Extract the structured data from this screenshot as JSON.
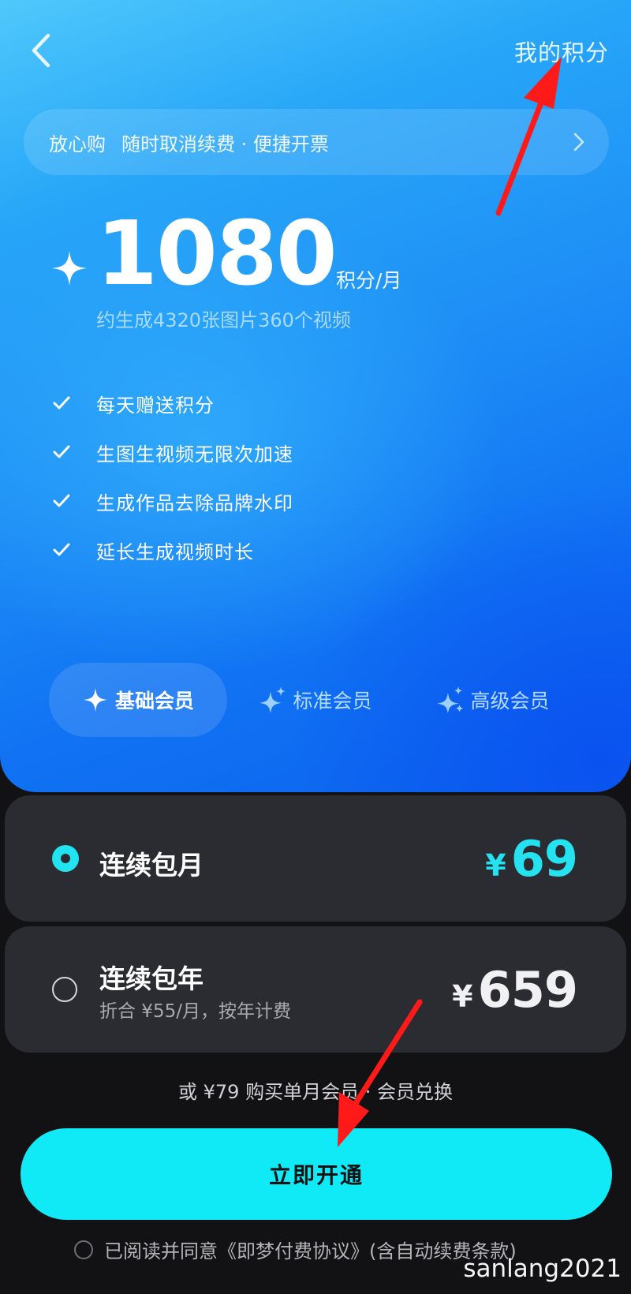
{
  "header": {
    "back_icon": "chevron-left-icon",
    "my_points_label": "我的积分"
  },
  "banner": {
    "tag": "放心购",
    "text": "随时取消续费 · 便捷开票",
    "arrow_icon": "chevron-right-icon"
  },
  "plan_summary": {
    "points": "1080",
    "unit": "积分/月",
    "subtitle": "约生成4320张图片360个视频"
  },
  "features": [
    {
      "label": "每天赠送积分"
    },
    {
      "label": "生图生视频无限次加速"
    },
    {
      "label": "生成作品去除品牌水印"
    },
    {
      "label": "延长生成视频时长"
    }
  ],
  "tiers": [
    {
      "label": "基础会员",
      "active": true
    },
    {
      "label": "标准会员",
      "active": false
    },
    {
      "label": "高级会员",
      "active": false
    }
  ],
  "plans": {
    "monthly": {
      "name": "连续包月",
      "currency": "¥",
      "price": "69",
      "selected": true
    },
    "yearly": {
      "name": "连续包年",
      "sub": "折合 ¥55/月，按年计费",
      "currency": "¥",
      "price": "659",
      "selected": false
    }
  },
  "alt_purchase": "或 ¥79 购买单月会员 · 会员兑换",
  "cta_label": "立即开通",
  "agreement": "已阅读并同意《即梦付费协议》(含自动续费条款)",
  "watermark": "sanlang2021",
  "colors": {
    "accent_cyan": "#10eaf6",
    "hero_blue": "#1e8ff6",
    "card_bg": "#2b2c31",
    "page_bg": "#121214",
    "annotation_red": "#ff1a1a"
  }
}
